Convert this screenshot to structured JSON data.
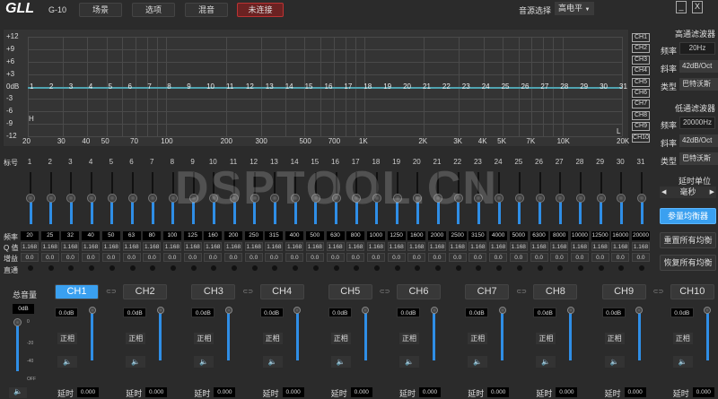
{
  "header": {
    "logo": "GLL",
    "model": "G-10",
    "tabs": [
      "场景",
      "选项",
      "混音"
    ],
    "connect": "未连接",
    "source_label": "音源选择",
    "source_value": "高电平",
    "min": "_",
    "close": "X"
  },
  "graph": {
    "y_ticks": [
      "+12",
      "+9",
      "+6",
      "+3",
      "0dB",
      "-3",
      "-6",
      "-9",
      "-12"
    ],
    "x_ticks": [
      "20",
      "30",
      "40",
      "50",
      "70",
      "100",
      "200",
      "300",
      "500",
      "700",
      "1K",
      "2K",
      "3K",
      "4K",
      "5K",
      "7K",
      "10K",
      "20K"
    ],
    "h_marker": "H",
    "l_marker": "L",
    "line_color": "#4fa3b0"
  },
  "channel_tags": [
    "CH1",
    "CH2",
    "CH3",
    "CH4",
    "CH5",
    "CH6",
    "CH7",
    "CH8",
    "CH9",
    "CH10"
  ],
  "highpass": {
    "title": "高通滤波器",
    "freq_label": "频率",
    "freq": "20Hz",
    "slope_label": "斜率",
    "slope": "42dB/Oct",
    "type_label": "类型",
    "type": "巴特沃斯"
  },
  "lowpass": {
    "title": "低通滤波器",
    "freq_label": "频率",
    "freq": "20000Hz",
    "slope_label": "斜率",
    "slope": "42dB/Oct",
    "type_label": "类型",
    "type": "巴特沃斯"
  },
  "delay_unit": {
    "title": "延时单位",
    "value": "毫秒"
  },
  "buttons": {
    "param_eq": "参量均衡器",
    "reset_all": "重置所有均衡",
    "restore_all": "恢复所有均衡"
  },
  "rows": {
    "index": "标号",
    "freq": "频率",
    "q": "Q 值",
    "gain": "增益",
    "bypass": "直通"
  },
  "bands": {
    "freqs": [
      "20",
      "25",
      "32",
      "40",
      "50",
      "63",
      "80",
      "100",
      "125",
      "160",
      "200",
      "250",
      "315",
      "400",
      "500",
      "630",
      "800",
      "1000",
      "1250",
      "1600",
      "2000",
      "2500",
      "3150",
      "4000",
      "5000",
      "6300",
      "8000",
      "10000",
      "12500",
      "16000",
      "20000"
    ],
    "q": "1.168",
    "gain": "0.0"
  },
  "master": {
    "label": "总音量",
    "value": "0dB",
    "scale": [
      "0",
      "-20",
      "-40",
      "OFF"
    ]
  },
  "channels": {
    "names": [
      "CH1",
      "CH2",
      "CH3",
      "CH4",
      "CH5",
      "CH6",
      "CH7",
      "CH8",
      "CH9",
      "CH10"
    ],
    "gain": "0.0dB",
    "phase": "正相",
    "delay_label": "延时",
    "delay": "0.000",
    "active": "CH1"
  },
  "watermark": "DSPTOOL.CN"
}
